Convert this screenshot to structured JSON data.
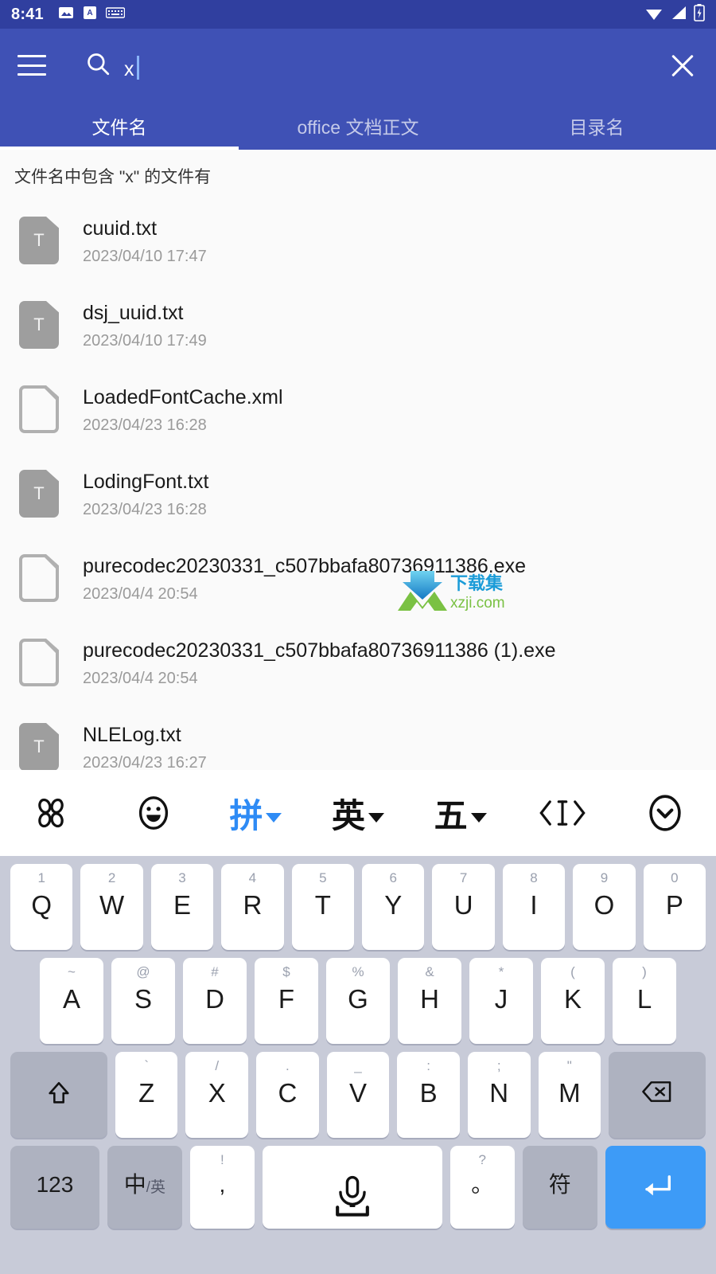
{
  "status_bar": {
    "time": "8:41",
    "left_icons": [
      "image-icon",
      "translate-icon",
      "keyboard-icon"
    ],
    "right_icons": [
      "wifi-icon",
      "signal-icon",
      "battery-icon"
    ],
    "background": "#303f9f"
  },
  "app_bar": {
    "background": "#3f51b5",
    "menu_icon": "hamburger-icon",
    "search_icon": "search-icon",
    "search_value": "x",
    "close_icon": "close-icon",
    "tabs": [
      {
        "label": "文件名",
        "active": true
      },
      {
        "label": "office 文档正文",
        "active": false
      },
      {
        "label": "目录名",
        "active": false
      }
    ]
  },
  "results": {
    "header": "文件名中包含 \"x\" 的文件有",
    "files": [
      {
        "icon": "txt-file-icon",
        "icon_letter": "T",
        "name": "cuuid.txt",
        "date": "2023/04/10  17:47"
      },
      {
        "icon": "txt-file-icon",
        "icon_letter": "T",
        "name": "dsj_uuid.txt",
        "date": "2023/04/10  17:49"
      },
      {
        "icon": "generic-file-icon",
        "icon_letter": "",
        "name": "LoadedFontCache.xml",
        "date": "2023/04/23  16:28"
      },
      {
        "icon": "txt-file-icon",
        "icon_letter": "T",
        "name": "LodingFont.txt",
        "date": "2023/04/23  16:28"
      },
      {
        "icon": "generic-file-icon",
        "icon_letter": "",
        "name": "purecodec20230331_c507bbafa80736911386.exe",
        "date": "2023/04/4  20:54"
      },
      {
        "icon": "generic-file-icon",
        "icon_letter": "",
        "name": "purecodec20230331_c507bbafa80736911386 (1).exe",
        "date": "2023/04/4  20:54"
      },
      {
        "icon": "txt-file-icon",
        "icon_letter": "T",
        "name": "NLELog.txt",
        "date": "2023/04/23  16:27"
      }
    ]
  },
  "watermark": {
    "title": "下载集",
    "domain": "xzji.com",
    "arrow_color": "#1b9cd8",
    "m_color": "#7ac143"
  },
  "fab": {
    "icon": "filter-icon",
    "color": "#3f51b5"
  },
  "keyboard": {
    "toolbar": [
      {
        "name": "apps-grid-icon",
        "glyph": "",
        "type": "icon"
      },
      {
        "name": "emoji-icon",
        "glyph": "",
        "type": "icon"
      },
      {
        "name": "pinyin-mode",
        "glyph": "拼",
        "type": "text",
        "active": true,
        "caret": true
      },
      {
        "name": "english-mode",
        "glyph": "英",
        "type": "text",
        "active": false,
        "caret": true
      },
      {
        "name": "wubi-mode",
        "glyph": "五",
        "type": "text",
        "active": false,
        "caret": true
      },
      {
        "name": "cursor-move-icon",
        "glyph": "‹I›",
        "type": "icon"
      },
      {
        "name": "collapse-keyboard-icon",
        "glyph": "",
        "type": "icon"
      }
    ],
    "rows": [
      [
        {
          "sub": "1",
          "main": "Q"
        },
        {
          "sub": "2",
          "main": "W"
        },
        {
          "sub": "3",
          "main": "E"
        },
        {
          "sub": "4",
          "main": "R"
        },
        {
          "sub": "5",
          "main": "T"
        },
        {
          "sub": "6",
          "main": "Y"
        },
        {
          "sub": "7",
          "main": "U"
        },
        {
          "sub": "8",
          "main": "I"
        },
        {
          "sub": "9",
          "main": "O"
        },
        {
          "sub": "0",
          "main": "P"
        }
      ],
      [
        {
          "sub": "~",
          "main": "A"
        },
        {
          "sub": "@",
          "main": "S"
        },
        {
          "sub": "#",
          "main": "D"
        },
        {
          "sub": "$",
          "main": "F"
        },
        {
          "sub": "%",
          "main": "G"
        },
        {
          "sub": "&",
          "main": "H"
        },
        {
          "sub": "*",
          "main": "J"
        },
        {
          "sub": "(",
          "main": "K"
        },
        {
          "sub": ")",
          "main": "L"
        }
      ],
      [
        {
          "sub": "",
          "main": "",
          "key": "shift",
          "icon": "shift-icon"
        },
        {
          "sub": "`",
          "main": "Z"
        },
        {
          "sub": "/",
          "main": "X"
        },
        {
          "sub": ".",
          "main": "C"
        },
        {
          "sub": "_",
          "main": "V"
        },
        {
          "sub": ":",
          "main": "B"
        },
        {
          "sub": ";",
          "main": "N"
        },
        {
          "sub": "\"",
          "main": "M"
        },
        {
          "sub": "",
          "main": "",
          "key": "backspace",
          "icon": "backspace-icon"
        }
      ]
    ],
    "bottom_row": [
      {
        "name": "numbers-key",
        "main": "123",
        "sub": "",
        "style": "fn"
      },
      {
        "name": "language-switch-key",
        "main": "中",
        "sub_inline": "/英",
        "style": "fn"
      },
      {
        "name": "comma-key",
        "main": ",",
        "sub": "!",
        "style": "white"
      },
      {
        "name": "space-key",
        "main": "",
        "sub": "",
        "style": "white",
        "icon": "microphone-icon"
      },
      {
        "name": "period-key",
        "main": "。",
        "sub": "?",
        "style": "white"
      },
      {
        "name": "symbols-key",
        "main": "符",
        "sub": "",
        "style": "fn"
      },
      {
        "name": "enter-key",
        "main": "",
        "sub": "",
        "style": "accent",
        "icon": "enter-icon"
      }
    ]
  }
}
